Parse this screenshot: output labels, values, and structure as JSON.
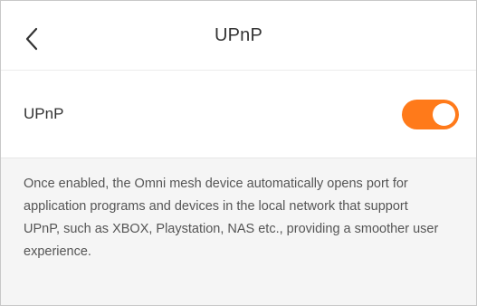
{
  "header": {
    "title": "UPnP",
    "back_icon": "chevron-left-icon"
  },
  "setting": {
    "label": "UPnP",
    "enabled": true,
    "accent_color": "#ff7a1a"
  },
  "description": "Once enabled, the Omni mesh device automatically opens port for application programs and devices in the local network that support UPnP, such as XBOX, Playstation, NAS etc., providing a smoother user experience."
}
